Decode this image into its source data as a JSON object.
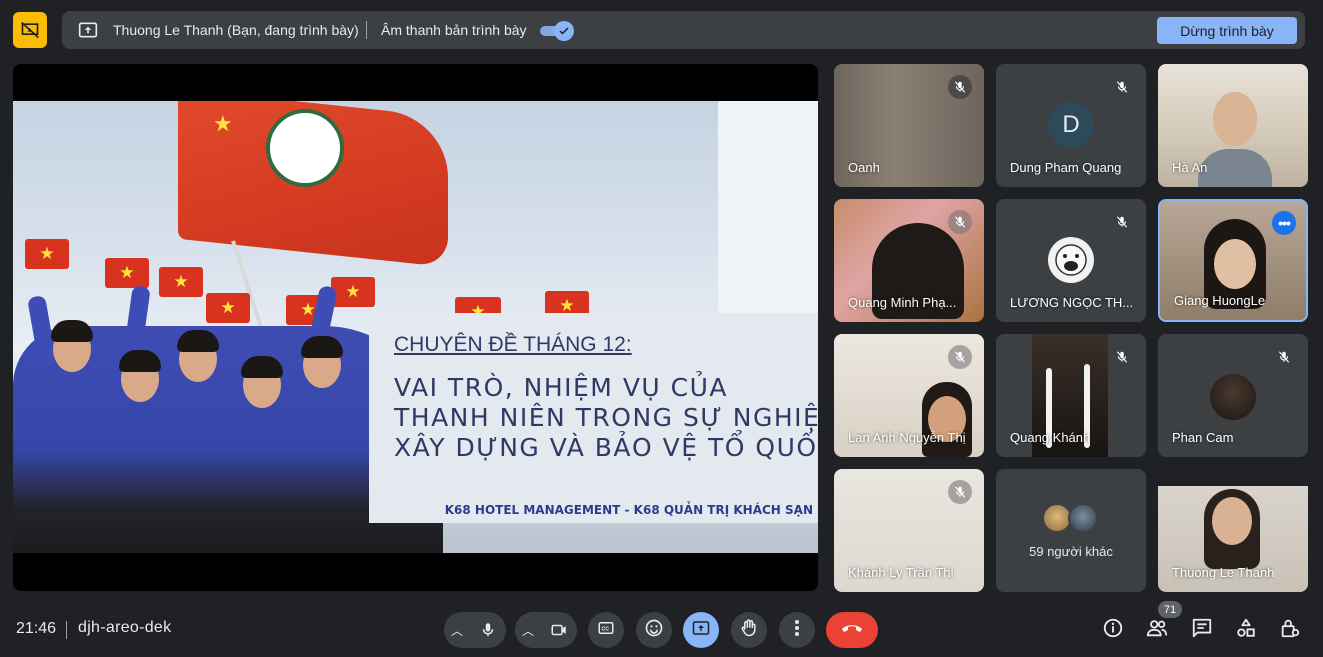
{
  "banner": {
    "presenter_text": "Thuong Le Thanh (Bạn, đang trình bày)",
    "audio_text": "Âm thanh bản trình bày",
    "audio_enabled": true,
    "stop_label": "Dừng trình bày"
  },
  "slide": {
    "subtitle": "CHUYÊN ĐỀ THÁNG 12:",
    "title_lines": [
      "VAI TRÒ, NHIỆM VỤ CỦA",
      "THANH NIÊN TRONG SỰ NGHIỆP",
      "XÂY DỰNG VÀ BẢO VỆ TỔ QUỐC"
    ],
    "footer": "K68 HOTEL MANAGEMENT - K68 QUẢN TRỊ KHÁCH SẠN"
  },
  "participants": [
    {
      "name": "Oanh",
      "muted": true
    },
    {
      "name": "Dung Pham Quang",
      "muted": true,
      "initial": "D"
    },
    {
      "name": "Hà An",
      "muted": false
    },
    {
      "name": "Quang Minh Phạ...",
      "muted": true
    },
    {
      "name": "LƯƠNG NGỌC TH...",
      "muted": true
    },
    {
      "name": "Giang HuongLe",
      "muted": false,
      "active": true
    },
    {
      "name": "Lan Anh Nguyễn Thị",
      "muted": true
    },
    {
      "name": "Quang Khánh",
      "muted": true
    },
    {
      "name": "Phan Cam",
      "muted": true
    },
    {
      "name": "Khánh Ly Trần Thị",
      "muted": true
    },
    {
      "name": "Thuong Le Thanh",
      "muted": false
    }
  ],
  "others_label": "59 người khác",
  "meeting": {
    "time": "21:46",
    "code": "djh-areo-dek",
    "participant_count": "71"
  },
  "icons": {
    "present_off": "present-to-all-off-icon",
    "mic": "mic-icon",
    "camera": "camera-icon",
    "captions": "closed-captions-icon",
    "emoji": "emoji-icon",
    "present": "present-to-all-icon",
    "hand": "raise-hand-icon",
    "more": "more-vert-icon",
    "hangup": "call-end-icon",
    "info": "info-icon",
    "people": "people-icon",
    "chat": "chat-icon",
    "activities": "activities-icon",
    "host": "host-controls-icon"
  },
  "colors": {
    "background": "#202124",
    "surface": "#3c4043",
    "accent": "#8ab4f8",
    "hangup": "#ea4335",
    "present_icon_bg": "#fbbc04"
  }
}
